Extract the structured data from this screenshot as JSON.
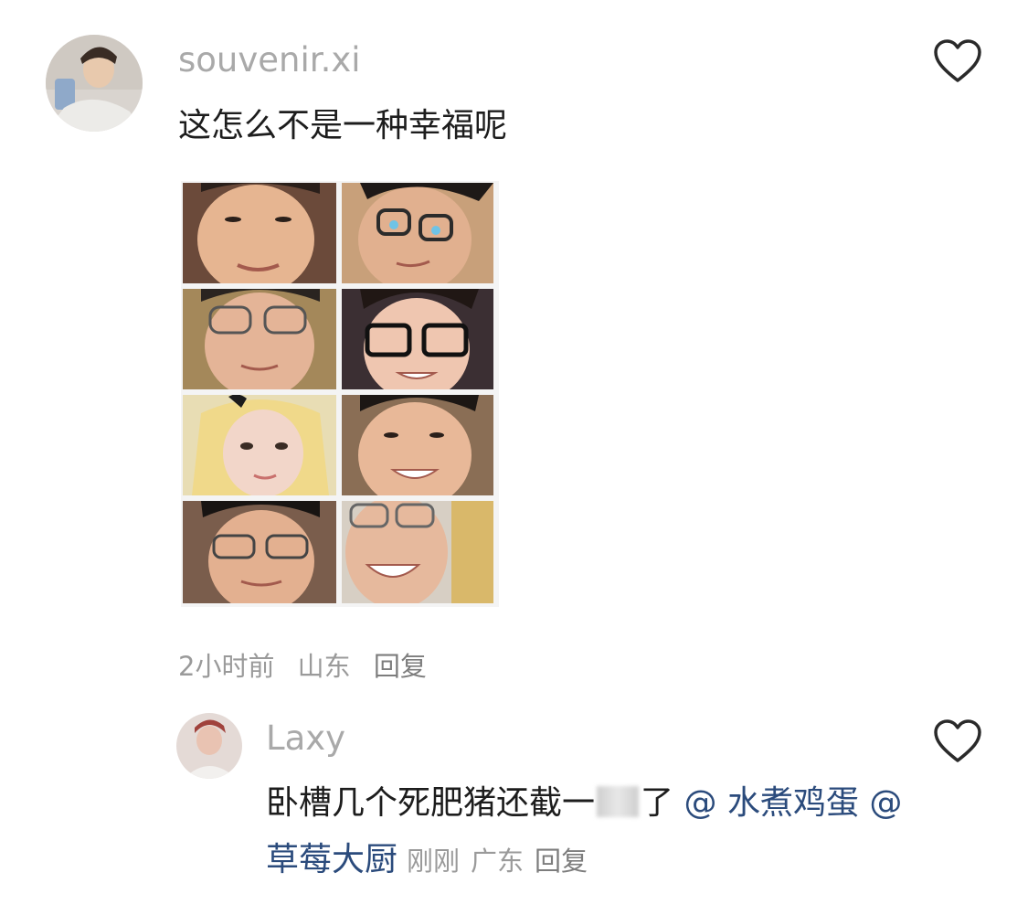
{
  "comment": {
    "username": "souvenir.xi",
    "text": "这怎么不是一种幸福呢",
    "time": "2小时前",
    "location": "山东",
    "reply_label": "回复",
    "avatar_icon": "user-avatar",
    "like_icon": "heart-outline-icon"
  },
  "reply": {
    "username": "Laxy",
    "text_before": "卧槽几个死肥猪还截",
    "text_after": "了",
    "mention1": "@ 水煮鸡蛋",
    "mention2": "@ 草莓大厨",
    "time": "刚刚",
    "location": "广东",
    "reply_label": "回复",
    "avatar_icon": "user-avatar",
    "like_icon": "heart-outline-icon"
  },
  "colors": {
    "username": "#a9a9a9",
    "mention": "#2b4b7c",
    "meta": "#9a9a9a",
    "text": "#1d1d1d"
  }
}
